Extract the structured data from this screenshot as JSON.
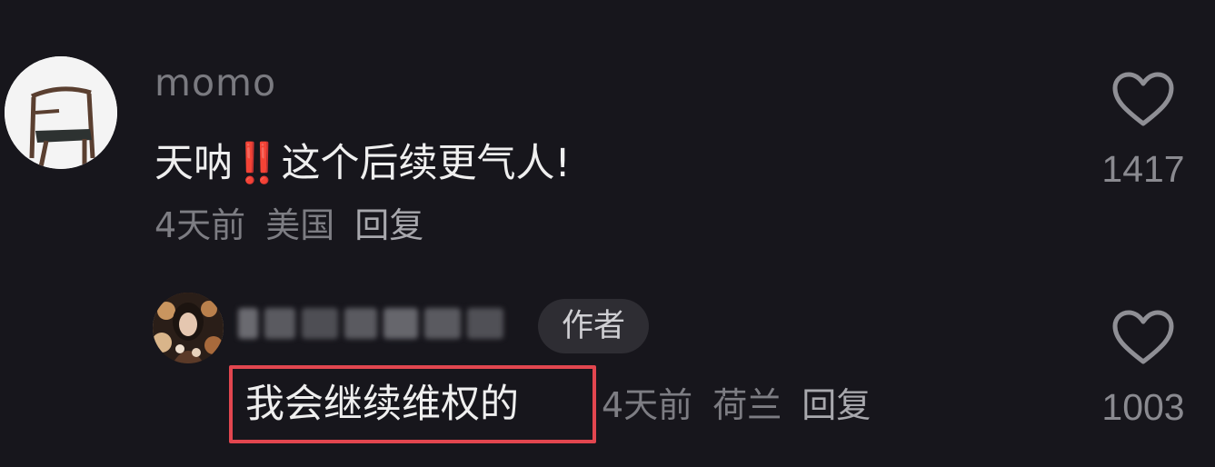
{
  "comments": [
    {
      "username": "momo",
      "text_before": "天呐",
      "emoji": "‼️",
      "text_after": "这个后续更气人!",
      "time": "4天前",
      "location": "美国",
      "reply_label": "回复",
      "like_count": "1417",
      "avatar_icon": "chair-avatar"
    },
    {
      "username_blurred": true,
      "badge": "作者",
      "text": "我会继续维权的",
      "time": "4天前",
      "location": "荷兰",
      "reply_label": "回复",
      "like_count": "1003",
      "highlight_color": "#e2464f",
      "avatar_icon": "woman-avatar"
    }
  ],
  "colors": {
    "background": "#17161c",
    "text": "#efefef",
    "muted": "#7d7d83"
  }
}
